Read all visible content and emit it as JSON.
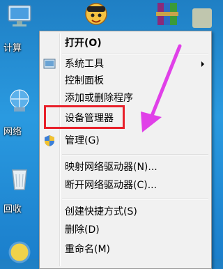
{
  "desktop": {
    "icons": [
      {
        "name": "computer-icon",
        "label": "计算"
      },
      {
        "name": "network-icon",
        "label": "网络"
      },
      {
        "name": "recycle-bin-icon",
        "label": "回收"
      }
    ]
  },
  "menu": {
    "items": [
      {
        "id": "open",
        "label": "打开(O)"
      },
      {
        "id": "system-tools",
        "label": "系统工具"
      },
      {
        "id": "control-panel",
        "label": "控制面板"
      },
      {
        "id": "add-remove",
        "label": "添加或删除程序"
      },
      {
        "id": "device-manager",
        "label": "设备管理器"
      },
      {
        "id": "manage",
        "label": "管理(G)"
      },
      {
        "id": "map-drive",
        "label": "映射网络驱动器(N)..."
      },
      {
        "id": "disconnect-drive",
        "label": "断开网络驱动器(C)..."
      },
      {
        "id": "create-shortcut",
        "label": "创建快捷方式(S)"
      },
      {
        "id": "delete",
        "label": "删除(D)"
      },
      {
        "id": "rename",
        "label": "重命名(M)"
      }
    ]
  },
  "colors": {
    "highlight_border": "#e8202a",
    "pointer_arrow": "#e040e8",
    "desktop_bg": "#2a9ae0"
  }
}
